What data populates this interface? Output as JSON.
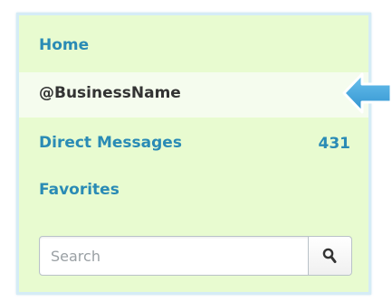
{
  "nav": {
    "items": [
      {
        "label": "Home"
      },
      {
        "label": "@BusinessName",
        "active": true
      },
      {
        "label": "Direct Messages",
        "count": "431"
      },
      {
        "label": "Favorites"
      }
    ]
  },
  "search": {
    "placeholder": "Search",
    "button_icon": "search-icon"
  },
  "annotation": {
    "icon": "arrow-left-icon",
    "color": "#3a9fd8"
  },
  "colors": {
    "panel_background": "#e8fbd0",
    "active_background": "#f5fcee",
    "link": "#2a8bb5",
    "active_text": "#333333"
  }
}
